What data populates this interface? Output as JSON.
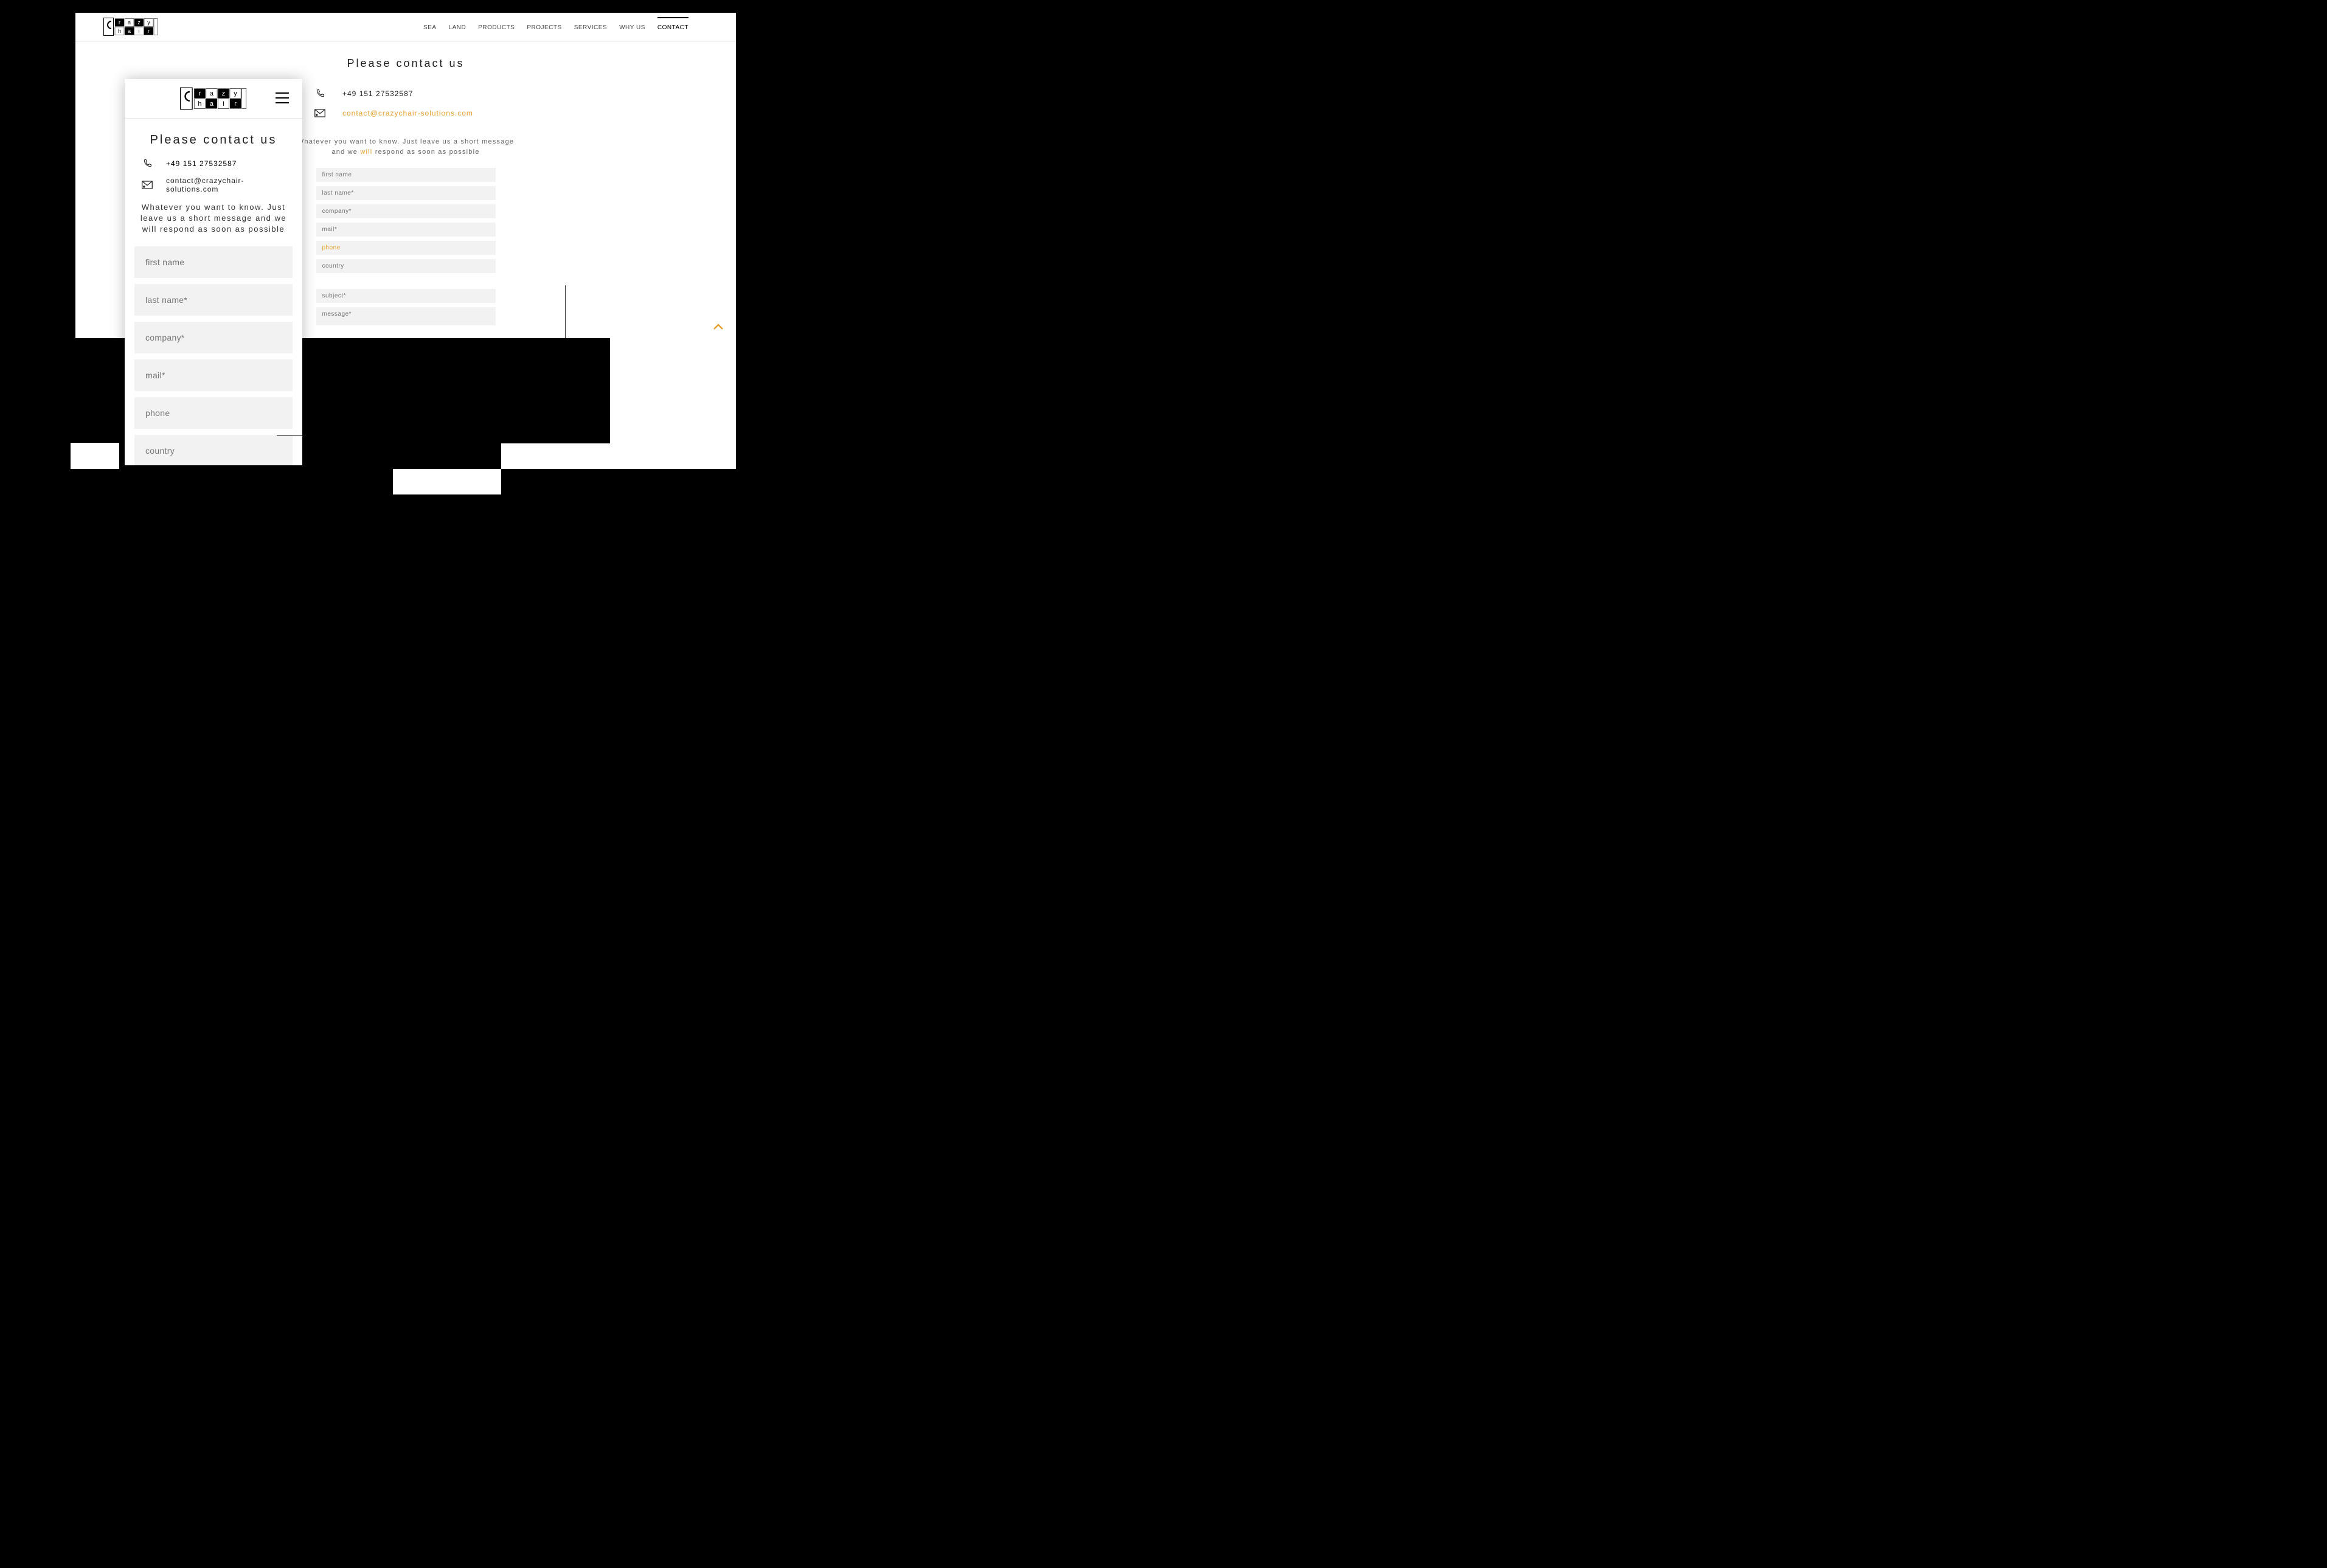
{
  "nav": {
    "items": [
      "SEA",
      "LAND",
      "PRODUCTS",
      "PROJECTS",
      "SERVICES",
      "WHY US",
      "CONTACT"
    ],
    "active_index": 6
  },
  "page": {
    "title": "Please contact us",
    "phone": "+49 151 27532587",
    "email": "contact@crazychair-solutions.com",
    "blurb_a": "Whatever you want to know. Just leave us a short message and we ",
    "blurb_hl": "will",
    "blurb_b": " respond as soon as possible",
    "blurb_mobile": "Whatever you want to know. Just leave us a short message and we will respond as soon as possible"
  },
  "form": {
    "first_name": "first name",
    "last_name": "last name*",
    "company": "company*",
    "mail": "mail*",
    "phone": "phone",
    "country": "country",
    "subject": "subject*",
    "message": "message*"
  },
  "icons": {
    "phone": "phone-icon",
    "mail": "mail-icon",
    "hamburger": "hamburger-icon",
    "chevron_up": "chevron-up-icon"
  },
  "logo": {
    "line1": "razy",
    "line2": "hair"
  }
}
